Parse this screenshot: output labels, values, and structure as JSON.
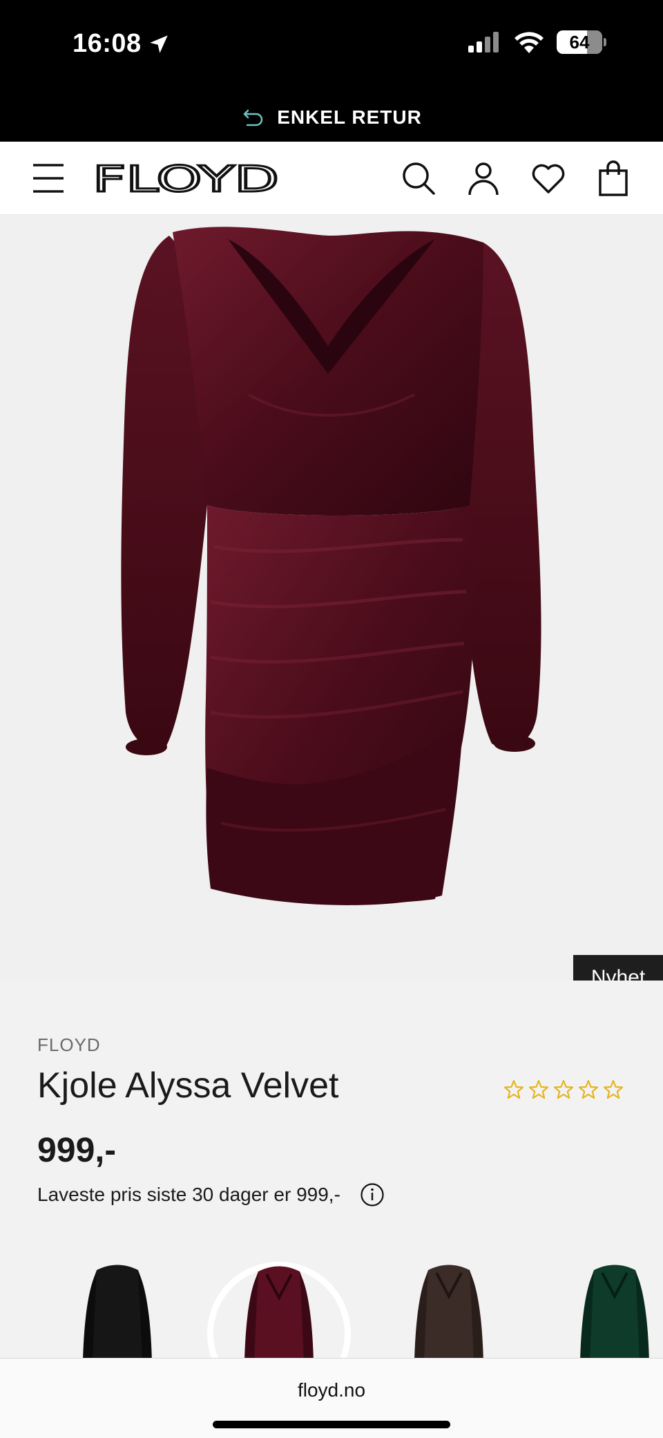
{
  "status_bar": {
    "time": "16:08",
    "battery": "64",
    "icons": [
      "location-arrow-icon",
      "signal-icon",
      "wifi-icon",
      "battery-icon"
    ]
  },
  "promo": {
    "text": "ENKEL RETUR",
    "icon": "return-arrow-icon"
  },
  "header": {
    "logo": "FLOYD",
    "icons": [
      "menu-icon",
      "search-icon",
      "account-icon",
      "heart-icon",
      "bag-icon"
    ]
  },
  "product": {
    "badge": "Nyhet",
    "brand": "FLOYD",
    "title": "Kjole Alyssa Velvet",
    "rating_stars": 0,
    "rating_max": 5,
    "price": "999,-",
    "lowest_price_note": "Laveste pris siste 30 dager er 999,-",
    "colors": [
      {
        "name": "black",
        "hex": "#161616"
      },
      {
        "name": "burgundy",
        "hex": "#5a1020",
        "selected": true
      },
      {
        "name": "brown",
        "hex": "#3b2c28"
      },
      {
        "name": "green",
        "hex": "#0e3b2a"
      }
    ]
  },
  "browser": {
    "url": "floyd.no"
  },
  "colors": {
    "accent_star": "#e6b422",
    "dress": "#5c1222"
  }
}
